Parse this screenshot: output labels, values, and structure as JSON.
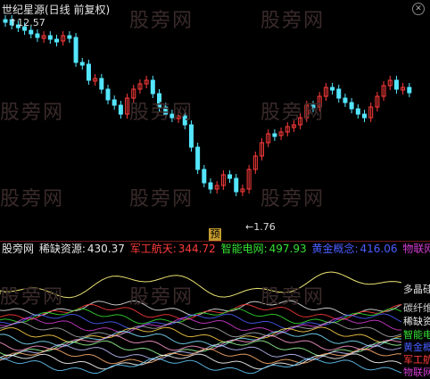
{
  "window": {
    "title": "世纪星源(日线 前复权)"
  },
  "watermark": "股旁网",
  "price_labels": {
    "high": "12.57",
    "low": "1.76",
    "forecast_tag": "预"
  },
  "indicator": {
    "name": "股旁网",
    "items": [
      {
        "label": "稀缺资源:",
        "value": "430.37",
        "color": "#e6e6e6"
      },
      {
        "label": "军工航天:",
        "value": "344.72",
        "color": "#ff3b3b"
      },
      {
        "label": "智能电网:",
        "value": "497.93",
        "color": "#35e035"
      },
      {
        "label": "黄金概念:",
        "value": "416.06",
        "color": "#4a5dff"
      },
      {
        "label": "物联网",
        "value": "",
        "color": "#d43cd4"
      }
    ]
  },
  "right_tags": [
    "多晶硅",
    "碳纤维",
    "稀缺资源",
    "智能电网",
    "黄金概念",
    "军工航天",
    "物联网"
  ],
  "colors": {
    "up": "#ff3b3b",
    "down": "#54e6ff",
    "bg": "#000000",
    "ma": "#ffffff"
  }
}
